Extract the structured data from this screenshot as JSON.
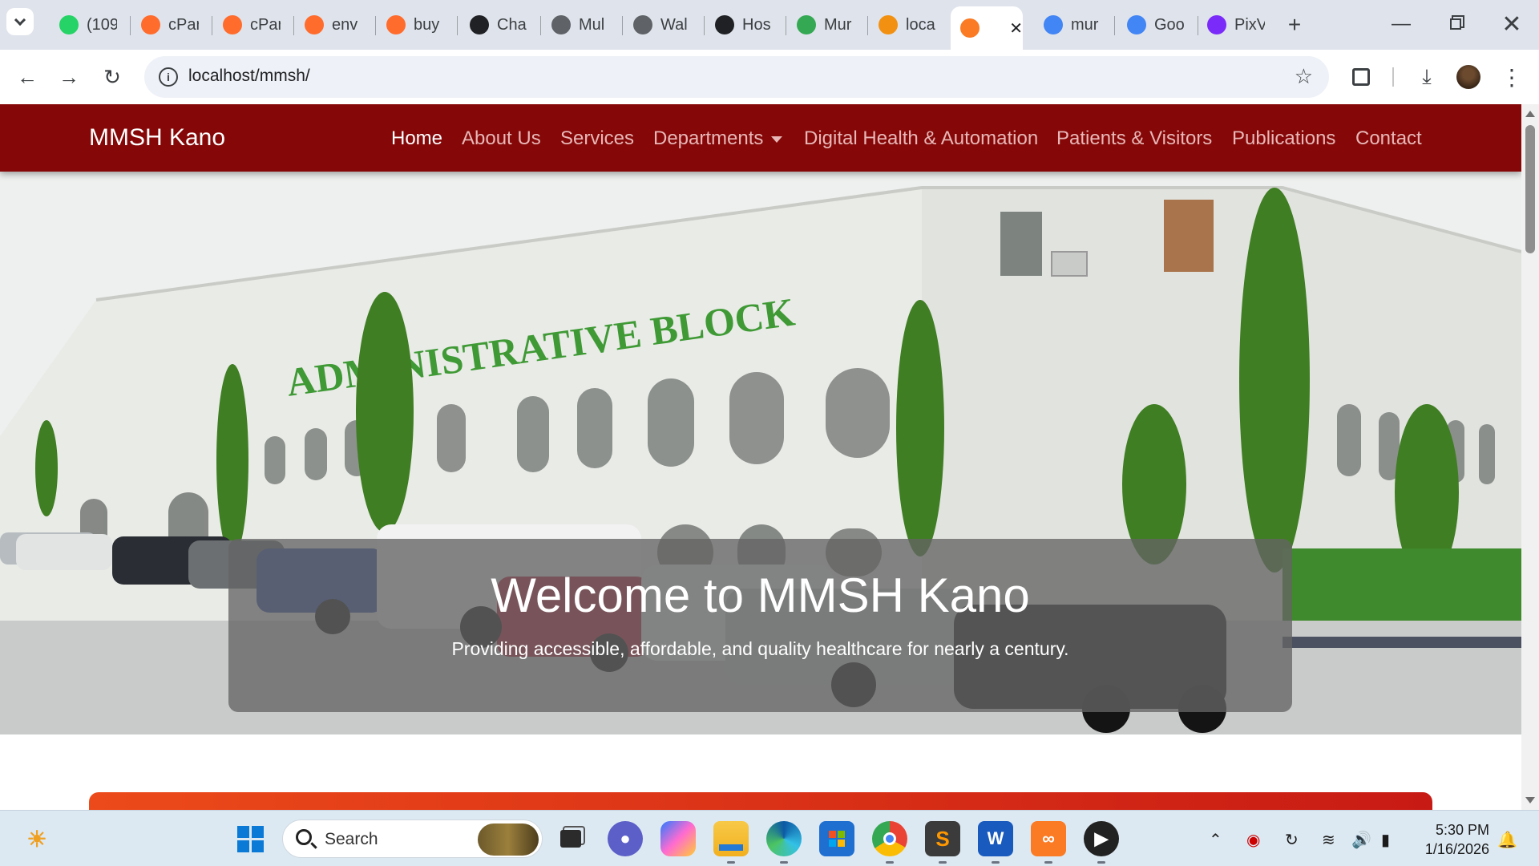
{
  "browser": {
    "tabs": [
      {
        "title": "(109",
        "icon": "whatsapp-icon",
        "color": "#25d366"
      },
      {
        "title": "cPar",
        "icon": "cpanel-icon",
        "color": "#ff6c2c"
      },
      {
        "title": "cPar",
        "icon": "cpanel-icon",
        "color": "#ff6c2c"
      },
      {
        "title": "env",
        "icon": "cpanel-icon",
        "color": "#ff6c2c"
      },
      {
        "title": "buy",
        "icon": "cpanel-icon",
        "color": "#ff6c2c"
      },
      {
        "title": "Cha",
        "icon": "chatgpt-icon",
        "color": "#202124"
      },
      {
        "title": "Mul",
        "icon": "globe-icon",
        "color": "#5f6368"
      },
      {
        "title": "Wal",
        "icon": "globe-icon",
        "color": "#5f6368"
      },
      {
        "title": "Hos",
        "icon": "chatgpt-icon",
        "color": "#202124"
      },
      {
        "title": "Mur",
        "icon": "maps-pin-icon",
        "color": "#34a853"
      },
      {
        "title": "loca",
        "icon": "phpmyadmin-icon",
        "color": "#f29111"
      },
      {
        "title": "",
        "icon": "xampp-icon",
        "color": "#fb7a24"
      },
      {
        "title": "mur",
        "icon": "google-icon",
        "color": "#4285f4"
      },
      {
        "title": "Goo",
        "icon": "gemini-icon",
        "color": "#4285f4"
      },
      {
        "title": "PixV",
        "icon": "pixverse-icon",
        "color": "#7b2bf9"
      }
    ],
    "url": "localhost/mmsh/",
    "new_tab": "+"
  },
  "site": {
    "brand": "MMSH Kano",
    "menu": [
      "Home",
      "About Us",
      "Services",
      "Departments",
      "Digital Health & Automation",
      "Patients & Visitors",
      "Publications",
      "Contact"
    ],
    "active_menu": "Home",
    "hero": {
      "sign_text": "ADMINISTRATIVE BLOCK",
      "title": "Welcome to MMSH Kano",
      "subtitle": "Providing accessible, affordable, and quality healthcare for nearly a century."
    },
    "accent_color": "#850707"
  },
  "taskbar": {
    "search_label": "Search",
    "time": "5:30 PM",
    "date": "1/16/2026"
  }
}
